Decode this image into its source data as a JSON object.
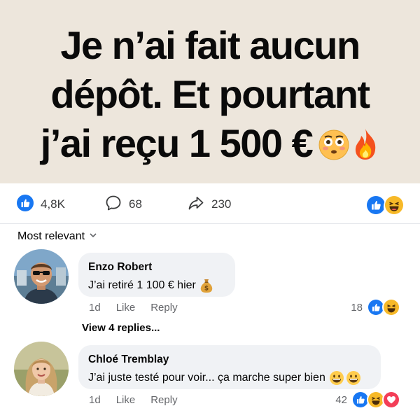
{
  "post": {
    "headline_lines": [
      "Je n’ai fait aucun",
      "dépôt. Et pourtant",
      "j’ai reçu 1 500 €"
    ],
    "headline_emojis": [
      "flushed-face",
      "fire"
    ]
  },
  "stats": {
    "likes": "4,8K",
    "comments": "68",
    "shares": "230",
    "reactions": [
      "like",
      "haha"
    ]
  },
  "sort": {
    "label": "Most relevant"
  },
  "comments": [
    {
      "author": "Enzo Robert",
      "text": "J’ai retiré 1 100 € hier",
      "emoji": "money-bag",
      "time": "1d",
      "like_label": "Like",
      "reply_label": "Reply",
      "reaction_count": "18",
      "reactions": [
        "like",
        "haha"
      ]
    },
    {
      "author": "Chloé Tremblay",
      "text": "J’ai juste testé pour voir... ça marche super bien",
      "emoji": "grinning-face",
      "time": "1d",
      "like_label": "Like",
      "reply_label": "Reply",
      "reaction_count": "42",
      "reactions": [
        "like",
        "haha",
        "love"
      ]
    }
  ],
  "view_replies": "View 4 replies...",
  "colors": {
    "banner": "#ede6dc",
    "like_blue": "#1877f2",
    "haha_yellow": "#f7b928",
    "love_red": "#f33e58"
  }
}
